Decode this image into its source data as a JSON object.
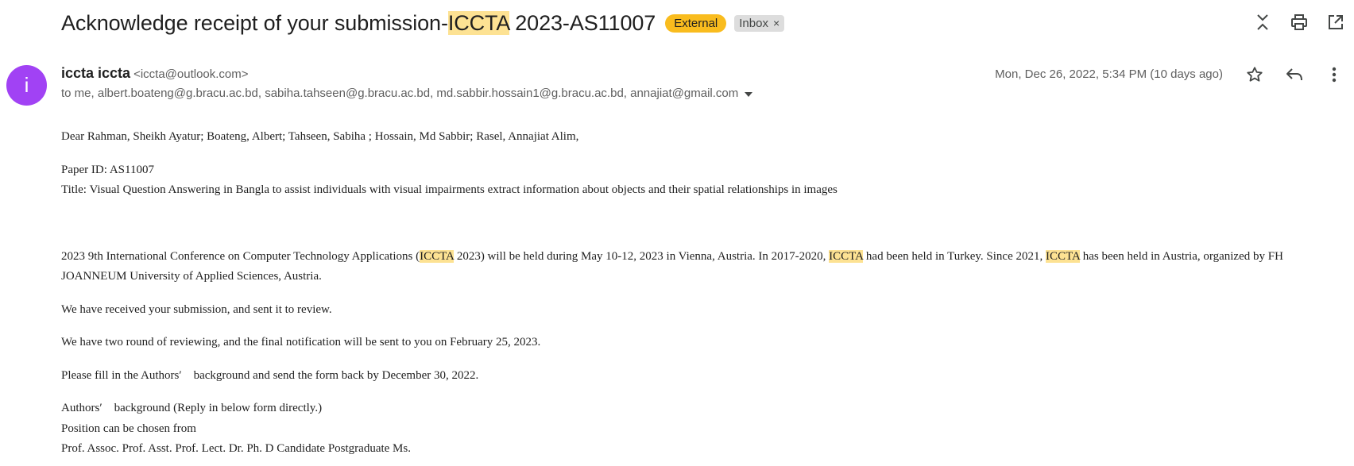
{
  "subject": {
    "prefix": "Acknowledge receipt of your submission-",
    "highlight": "ICCTA",
    "suffix": " 2023-AS11007",
    "external_label": "External",
    "inbox_label": "Inbox",
    "inbox_close": "×"
  },
  "sender": {
    "avatar_letter": "i",
    "name": "iccta iccta",
    "email": "<iccta@outlook.com>",
    "to": "to me, albert.boateng@g.bracu.ac.bd, sabiha.tahseen@g.bracu.ac.bd, md.sabbir.hossain1@g.bracu.ac.bd, annajiat@gmail.com",
    "date": "Mon, Dec 26, 2022, 5:34 PM (10 days ago)"
  },
  "body": {
    "greeting": "Dear Rahman, Sheikh Ayatur; Boateng, Albert; Tahseen, Sabiha ; Hossain, Md Sabbir; Rasel, Annajiat Alim,",
    "paper_id": "Paper ID: AS11007",
    "title": "Title: Visual Question Answering in Bangla to assist individuals with visual impairments extract information about objects and their spatial relationships in images",
    "conf_1": "2023 9th International Conference on Computer Technology Applications (",
    "conf_hl_1": "ICCTA",
    "conf_2": " 2023) will be held during May 10-12, 2023 in Vienna, Austria. In 2017-2020, ",
    "conf_hl_2": "ICCTA",
    "conf_3": " had been held in Turkey. Since 2021, ",
    "conf_hl_3": "ICCTA",
    "conf_4": " has been held in Austria, organized by FH JOANNEUM University of Applied Sciences, Austria.",
    "received": "We have received your submission, and sent it to review.",
    "review": "We have two round of reviewing, and the final notification will be sent to you on February 25, 2023.",
    "fill": "Please fill in the Authors′　background and send the form back by December 30, 2022.",
    "authors_bg": "Authors′　background (Reply in below form directly.)",
    "position": "Position  can be chosen from",
    "positions_list": "Prof.  Assoc.  Prof.  Asst. Prof.  Lect.  Dr.  Ph. D Candidate  Postgraduate  Ms."
  },
  "icons": {
    "top": [
      "collapse-icon",
      "print-icon",
      "open-in-new-window-icon"
    ],
    "header": [
      "star-icon",
      "reply-icon",
      "more-vert-icon"
    ]
  },
  "colors": {
    "highlight": "#fde293",
    "external_badge": "#f9bc1e",
    "avatar": "#a142f4"
  }
}
